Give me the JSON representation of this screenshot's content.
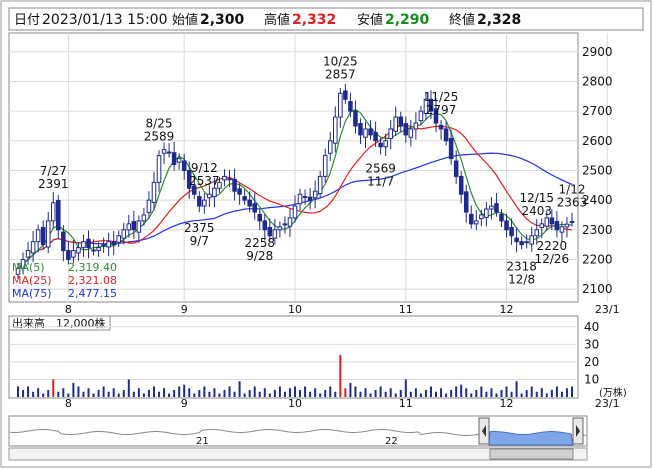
{
  "header": {
    "date_label": "日付",
    "date": "2023/01/13 15:00",
    "open_label": "始値",
    "open": "2,300",
    "high_label": "高値",
    "high": "2,332",
    "low_label": "安値",
    "low": "2,290",
    "close_label": "終値",
    "close": "2,328"
  },
  "colors": {
    "up": "#ffffff",
    "down": "#1f2a8c",
    "candle_outline": "#1f2a8c",
    "ma5": "#2e8b2e",
    "ma25": "#e02020",
    "ma75": "#2030e0",
    "high_value": "#e02020",
    "low_value": "#1a8a1a",
    "volume_bar": "#1f2a8c",
    "volume_spike": "#e02020",
    "nav_fill": "#7fa6e8",
    "grid": "#d8d8d8"
  },
  "ma_legend": [
    {
      "label": "MA(5)",
      "value": "2,319.40",
      "color": "#2e8b2e"
    },
    {
      "label": "MA(25)",
      "value": "2,321.08",
      "color": "#e02020"
    },
    {
      "label": "MA(75)",
      "value": "2,477.15",
      "color": "#2030e0"
    }
  ],
  "volume_header": {
    "label": "出来高",
    "value": "12,000株"
  },
  "volume_unit": "(万株)",
  "nav_labels": [
    "21",
    "22"
  ],
  "chart_data": [
    {
      "type": "candlestick",
      "x_ticks": [
        "8",
        "9",
        "10",
        "11",
        "12",
        "23/1"
      ],
      "y_ticks": [
        2100,
        2200,
        2300,
        2400,
        2500,
        2600,
        2700,
        2800,
        2900
      ],
      "ylim": [
        2060,
        2960
      ],
      "grid": true,
      "x": [
        0,
        1,
        2,
        3,
        4,
        5,
        6,
        7,
        8,
        9,
        10,
        11,
        12,
        13,
        14,
        15,
        16,
        17,
        18,
        19,
        20,
        21,
        22,
        23,
        24,
        25,
        26,
        27,
        28,
        29,
        30,
        31,
        32,
        33,
        34,
        35,
        36,
        37,
        38,
        39,
        40,
        41,
        42,
        43,
        44,
        45,
        46,
        47,
        48,
        49,
        50,
        51,
        52,
        53,
        54,
        55,
        56,
        57,
        58,
        59,
        60,
        61,
        62,
        63,
        64,
        65,
        66,
        67,
        68,
        69,
        70,
        71,
        72,
        73,
        74,
        75,
        76,
        77,
        78,
        79,
        80,
        81,
        82,
        83,
        84,
        85,
        86,
        87,
        88,
        89,
        90,
        91,
        92,
        93,
        94,
        95,
        96,
        97,
        98,
        99,
        100,
        101,
        102,
        103,
        104,
        105,
        106,
        107,
        108,
        109,
        110,
        111,
        112,
        113,
        114,
        115,
        116,
        117,
        118,
        119,
        120,
        121,
        122,
        123,
        124,
        125,
        126,
        127,
        128,
        129,
        130,
        131,
        132,
        133,
        134,
        135,
        136,
        137,
        138
      ],
      "close": [
        2170,
        2200,
        2230,
        2260,
        2300,
        2250,
        2330,
        2391,
        2300,
        2230,
        2200,
        2230,
        2240,
        2260,
        2240,
        2230,
        2240,
        2250,
        2260,
        2250,
        2280,
        2300,
        2320,
        2300,
        2330,
        2350,
        2400,
        2460,
        2550,
        2570,
        2560,
        2520,
        2540,
        2500,
        2440,
        2420,
        2380,
        2400,
        2420,
        2440,
        2460,
        2480,
        2470,
        2430,
        2420,
        2400,
        2380,
        2360,
        2330,
        2300,
        2280,
        2300,
        2310,
        2320,
        2340,
        2380,
        2420,
        2410,
        2400,
        2430,
        2480,
        2550,
        2600,
        2680,
        2760,
        2740,
        2700,
        2650,
        2620,
        2640,
        2620,
        2600,
        2580,
        2600,
        2640,
        2680,
        2650,
        2620,
        2640,
        2660,
        2700,
        2740,
        2700,
        2660,
        2640,
        2600,
        2540,
        2480,
        2420,
        2360,
        2320,
        2330,
        2350,
        2370,
        2380,
        2360,
        2330,
        2300,
        2280,
        2260,
        2250,
        2260,
        2280,
        2300,
        2320,
        2340,
        2320,
        2300,
        2310,
        2319,
        2328
      ],
      "ohlc_note": "daily candles, first trading day ~2022/07/19",
      "annotations": [
        {
          "label": "7/27",
          "value": "2391",
          "kind": "high"
        },
        {
          "label": "8/25",
          "value": "2589",
          "kind": "high"
        },
        {
          "label": "9/12",
          "value": "2537",
          "kind": "high"
        },
        {
          "label": "2375",
          "value": "9/7",
          "kind": "low"
        },
        {
          "label": "2258",
          "value": "9/28",
          "kind": "low"
        },
        {
          "label": "10/25",
          "value": "2857",
          "kind": "high"
        },
        {
          "label": "2569",
          "value": "11/7",
          "kind": "low"
        },
        {
          "label": "11/25",
          "value": "2797",
          "kind": "high"
        },
        {
          "label": "12/15",
          "value": "2403",
          "kind": "high"
        },
        {
          "label": "2318",
          "value": "12/8",
          "kind": "low"
        },
        {
          "label": "2220",
          "value": "12/26",
          "kind": "low"
        },
        {
          "label": "1/12",
          "value": "2363",
          "kind": "high"
        }
      ]
    },
    {
      "type": "bar",
      "title": "出来高",
      "y_ticks": [
        10,
        20,
        30,
        40
      ],
      "ylim": [
        0,
        45
      ],
      "x_ticks": [
        "8",
        "9",
        "10",
        "11",
        "12",
        "23/1"
      ],
      "values_note": "daily volume in 万株; large spikes near start of Aug and late Oct"
    }
  ]
}
